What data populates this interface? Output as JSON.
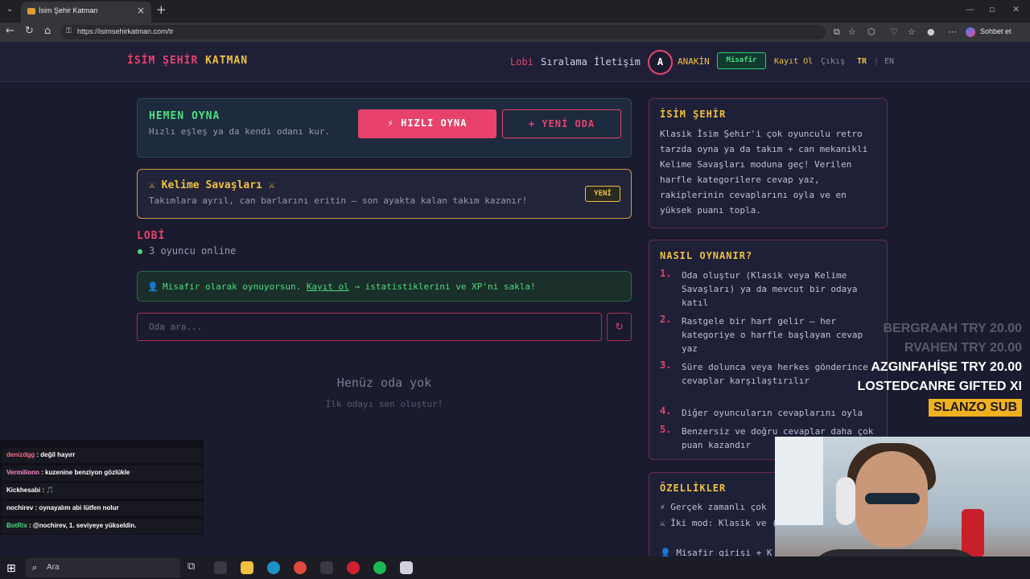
{
  "browser": {
    "tab_title": "İsim Şehir Katman",
    "tab_close": "×",
    "new_tab": "+",
    "tab_menu": "⌄",
    "url": "https://isimsehirkatman.com/tr",
    "copilot_label": "Sohbet et",
    "window_controls": [
      "—",
      "▫",
      "✕"
    ],
    "nav": {
      "back": "←",
      "reload": "↻",
      "home": "⌂"
    }
  },
  "header": {
    "logo_part1": "İSİM ŞEHİR",
    "logo_part2": "KATMAN",
    "nav": [
      "Lobi",
      "Sıralama",
      "İletişim"
    ],
    "avatar_letter": "A",
    "username": "ANAKİN",
    "guest_badge": "Misafir",
    "signup": "Kayıt Ol",
    "logout": "Çıkış",
    "languages": [
      "TR",
      "EN"
    ],
    "lang_separator": "|"
  },
  "play": {
    "title": "HEMEN OYNA",
    "subtitle": "Hızlı eşleş ya da kendi odanı kur.",
    "quick_button": "⚡ HIZLI OYNA",
    "new_room_button": "+ YENİ ODA"
  },
  "word_wars": {
    "title": "⚔ Kelime Savaşları ⚔",
    "subtitle": "Takımlara ayrıl, can barlarını eritin — son ayakta kalan takım kazanır!",
    "badge": "YENİ"
  },
  "lobby": {
    "title": "LOBİ",
    "online": "3 oyuncu online",
    "guest_icon": "👤",
    "guest_prefix": "Misafir olarak oynuyorsun.",
    "guest_link": "Kayıt ol",
    "guest_suffix": "→ istatistiklerini ve XP'ni sakla!",
    "search_placeholder": "Oda ara...",
    "refresh_icon": "↻",
    "empty_title": "Henüz oda yok",
    "empty_subtitle": "İlk odayı sen oluştur!"
  },
  "about": {
    "title": "İSİM ŞEHİR",
    "text": "Klasik İsim Şehir'i çok oyunculu retro tarzda oyna ya da takım + can mekanikli Kelime Savaşları moduna geç! Verilen harfle kategorilere cevap yaz, rakiplerinin cevaplarını oyla ve en yüksek puanı topla."
  },
  "howto": {
    "title": "NASIL OYNANIR?",
    "steps": [
      {
        "num": "1.",
        "text": "Oda oluştur (Klasik veya Kelime Savaşları) ya da mevcut bir odaya katıl"
      },
      {
        "num": "2.",
        "text": "Rastgele bir harf gelir — her kategoriye o harfle başlayan cevap yaz"
      },
      {
        "num": "3.",
        "text": "Süre dolunca veya herkes gönderince cevaplar karşılaştırılır"
      },
      {
        "num": "4.",
        "text": "Diğer oyuncuların cevaplarını oyla"
      },
      {
        "num": "5.",
        "text": "Benzersiz ve doğru cevaplar daha çok puan kazandır"
      }
    ]
  },
  "features": {
    "title": "ÖZELLİKLER",
    "items": [
      "⚡ Gerçek zamanlı çok",
      "⚔ İki mod: Klasik ve (takım + can)",
      "👤 Misafir girişi + K"
    ]
  },
  "donations": [
    {
      "name": "BERGRAAH",
      "amount": "TRY 20.00"
    },
    {
      "name": "RVAHEN",
      "amount": "TRY 20.00"
    },
    {
      "name": "AZGINFAHİŞE",
      "amount": "TRY 20.00"
    },
    {
      "name": "LOSTEDCANRE",
      "amount": "GIFTED XI"
    }
  ],
  "sub_alert": "SLANZO SUB",
  "chat": [
    {
      "user": "denizdgg",
      "msg": ": değil hayırr",
      "color": "#ff6a8a"
    },
    {
      "user": "Vermilionn",
      "msg": ": kuzenine benziyon gözlükle",
      "color": "#ff8ad0"
    },
    {
      "user": "Kickhesabi",
      "msg": ": 🎵",
      "color": "#ffffff"
    },
    {
      "user": "nochirev",
      "msg": ": oynayalım abi lütfen nolur",
      "color": "#ffffff"
    },
    {
      "user": "BotRix",
      "msg": ": @nochirev, 1. seviyeye yükseldin.",
      "color": "#4ade80"
    }
  ],
  "taskbar": {
    "start_icon": "⊞",
    "search_icon": "⌕",
    "search_text": "Ara"
  },
  "colors": {
    "accent": "#e8426c",
    "gold": "#f0c040",
    "green": "#4ade80",
    "bg": "#1a1b2e"
  }
}
